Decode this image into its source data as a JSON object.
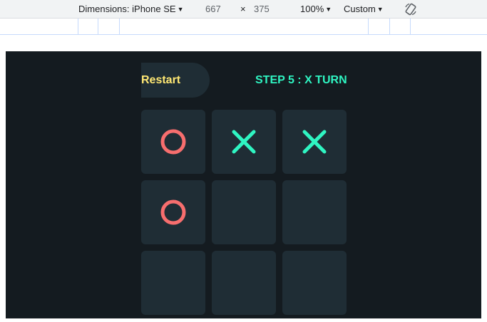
{
  "devtools": {
    "dimensions_label": "Dimensions: iPhone SE",
    "width": "667",
    "times": "×",
    "height": "375",
    "zoom": "100%",
    "throttle": "Custom",
    "rotate_icon": "rotate-icon"
  },
  "game": {
    "restart_label": "Restart",
    "status": "STEP 5 : X TURN",
    "colors": {
      "background": "#141b20",
      "cell": "#1f2d35",
      "x": "#2ff5c2",
      "o": "#f76e6e",
      "restart": "#ffe873"
    },
    "board": [
      "O",
      "X",
      "X",
      "O",
      "",
      "",
      "",
      "",
      ""
    ]
  }
}
